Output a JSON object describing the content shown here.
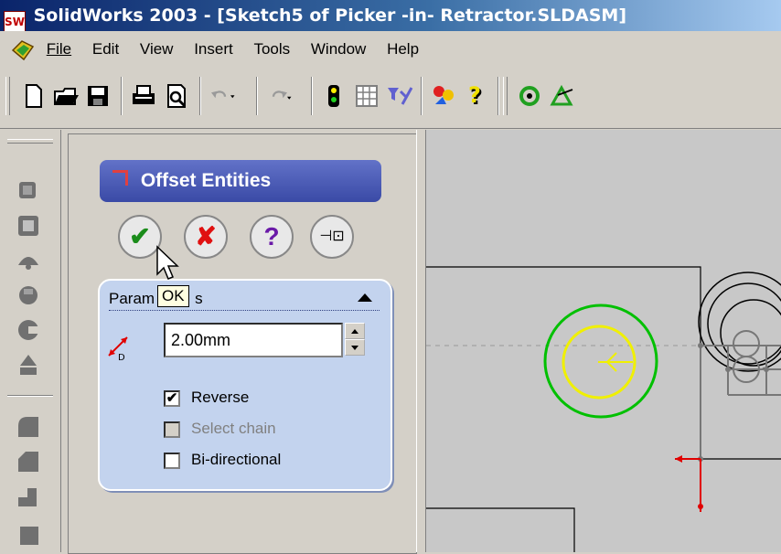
{
  "window": {
    "title": "SolidWorks 2003 - [Sketch5 of Picker -in- Retractor.SLDASM]",
    "app_icon": "SW"
  },
  "menu": {
    "items": [
      {
        "label": "File"
      },
      {
        "label": "Edit"
      },
      {
        "label": "View"
      },
      {
        "label": "Insert"
      },
      {
        "label": "Tools"
      },
      {
        "label": "Window"
      },
      {
        "label": "Help"
      }
    ]
  },
  "toolbar": {
    "icons": [
      "new-doc-icon",
      "open-folder-icon",
      "save-icon",
      "print-icon",
      "print-preview-icon",
      "undo-icon",
      "redo-icon",
      "traffic-light-icon",
      "grid-icon",
      "filter-icon",
      "select-icon",
      "help-icon",
      "rebuild-icon",
      "view-icon"
    ]
  },
  "property_manager": {
    "title": "Offset Entities",
    "buttons": {
      "ok_symbol": "✔",
      "cancel_symbol": "✘",
      "help_symbol": "?",
      "pin_symbol": "⊣⊡"
    },
    "tooltip": "OK",
    "group": {
      "title_visible_left": "Param",
      "title_visible_right": "s",
      "distance_value": "2.00mm",
      "distance_icon_label": "D",
      "checkboxes": [
        {
          "label": "Reverse",
          "checked": true,
          "enabled": true
        },
        {
          "label": "Select chain",
          "checked": false,
          "enabled": false
        },
        {
          "label": "Bi-directional",
          "checked": false,
          "enabled": true
        }
      ]
    }
  },
  "colors": {
    "title_bar": "#0a246a",
    "pm_header": "#4a5ab8",
    "group_bg": "#c3d3ee",
    "sketch_green": "#00c000",
    "sketch_yellow": "#f0f000",
    "sketch_red": "#e00000",
    "ok_green": "#1a8c1a",
    "cancel_red": "#e01010",
    "help_purple": "#6a1aa8"
  }
}
